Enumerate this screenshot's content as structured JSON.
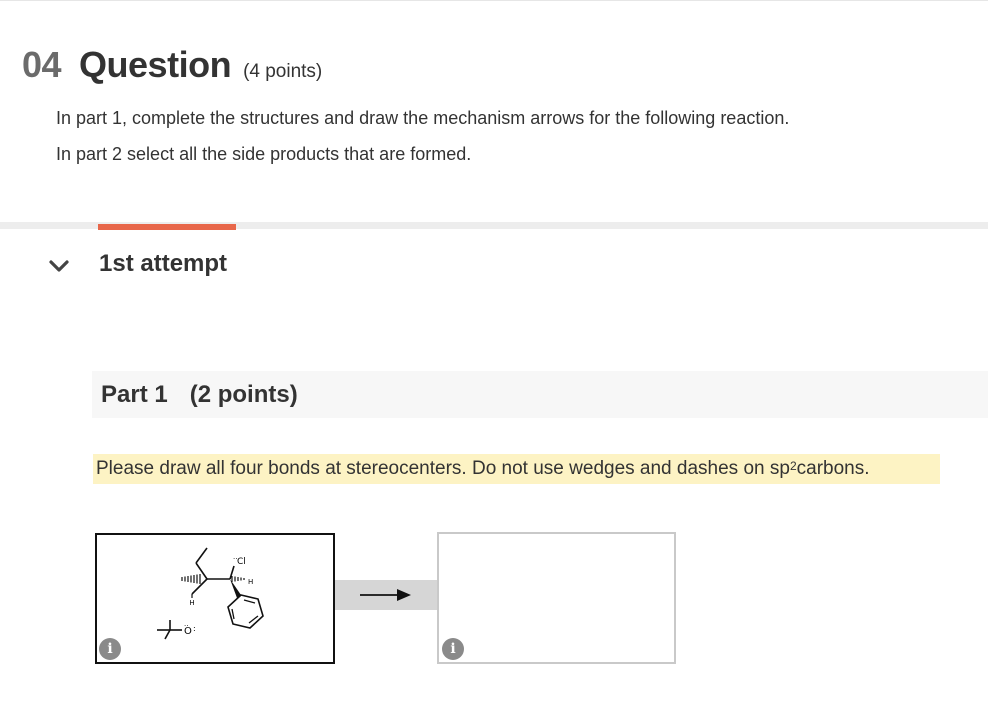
{
  "question": {
    "number": "04",
    "title": "Question",
    "points": "(4 points)",
    "instructions": [
      "In part 1, complete the structures and draw the mechanism arrows for the following reaction.",
      "In part 2 select all the side products that are formed."
    ]
  },
  "attempt": {
    "title": "1st attempt",
    "accent_color": "#e8674a"
  },
  "part": {
    "label": "Part 1",
    "points": "(2 points)"
  },
  "note": {
    "text_before": "Please draw all four bonds at stereocenters. Do not use wedges and dashes on sp",
    "superscript": "2",
    "text_after": " carbons.",
    "highlight_color": "#fdf3c4"
  },
  "reaction": {
    "reactant_labels": {
      "h_left": "H",
      "h_right": "H",
      "chloride": "Cl",
      "alkoxide": "O"
    },
    "arrow_icon": "right-arrow-icon",
    "info_icon": "info-icon",
    "info_glyph": "i"
  }
}
